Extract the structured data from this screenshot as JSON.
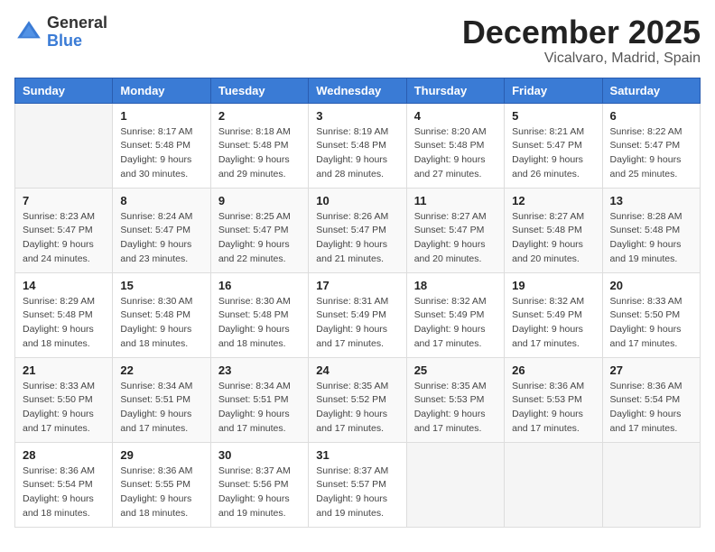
{
  "logo": {
    "general": "General",
    "blue": "Blue"
  },
  "header": {
    "month": "December 2025",
    "location": "Vicalvaro, Madrid, Spain"
  },
  "weekdays": [
    "Sunday",
    "Monday",
    "Tuesday",
    "Wednesday",
    "Thursday",
    "Friday",
    "Saturday"
  ],
  "weeks": [
    [
      {
        "day": "",
        "sunrise": "",
        "sunset": "",
        "daylight": ""
      },
      {
        "day": "1",
        "sunrise": "Sunrise: 8:17 AM",
        "sunset": "Sunset: 5:48 PM",
        "daylight": "Daylight: 9 hours and 30 minutes."
      },
      {
        "day": "2",
        "sunrise": "Sunrise: 8:18 AM",
        "sunset": "Sunset: 5:48 PM",
        "daylight": "Daylight: 9 hours and 29 minutes."
      },
      {
        "day": "3",
        "sunrise": "Sunrise: 8:19 AM",
        "sunset": "Sunset: 5:48 PM",
        "daylight": "Daylight: 9 hours and 28 minutes."
      },
      {
        "day": "4",
        "sunrise": "Sunrise: 8:20 AM",
        "sunset": "Sunset: 5:48 PM",
        "daylight": "Daylight: 9 hours and 27 minutes."
      },
      {
        "day": "5",
        "sunrise": "Sunrise: 8:21 AM",
        "sunset": "Sunset: 5:47 PM",
        "daylight": "Daylight: 9 hours and 26 minutes."
      },
      {
        "day": "6",
        "sunrise": "Sunrise: 8:22 AM",
        "sunset": "Sunset: 5:47 PM",
        "daylight": "Daylight: 9 hours and 25 minutes."
      }
    ],
    [
      {
        "day": "7",
        "sunrise": "Sunrise: 8:23 AM",
        "sunset": "Sunset: 5:47 PM",
        "daylight": "Daylight: 9 hours and 24 minutes."
      },
      {
        "day": "8",
        "sunrise": "Sunrise: 8:24 AM",
        "sunset": "Sunset: 5:47 PM",
        "daylight": "Daylight: 9 hours and 23 minutes."
      },
      {
        "day": "9",
        "sunrise": "Sunrise: 8:25 AM",
        "sunset": "Sunset: 5:47 PM",
        "daylight": "Daylight: 9 hours and 22 minutes."
      },
      {
        "day": "10",
        "sunrise": "Sunrise: 8:26 AM",
        "sunset": "Sunset: 5:47 PM",
        "daylight": "Daylight: 9 hours and 21 minutes."
      },
      {
        "day": "11",
        "sunrise": "Sunrise: 8:27 AM",
        "sunset": "Sunset: 5:47 PM",
        "daylight": "Daylight: 9 hours and 20 minutes."
      },
      {
        "day": "12",
        "sunrise": "Sunrise: 8:27 AM",
        "sunset": "Sunset: 5:48 PM",
        "daylight": "Daylight: 9 hours and 20 minutes."
      },
      {
        "day": "13",
        "sunrise": "Sunrise: 8:28 AM",
        "sunset": "Sunset: 5:48 PM",
        "daylight": "Daylight: 9 hours and 19 minutes."
      }
    ],
    [
      {
        "day": "14",
        "sunrise": "Sunrise: 8:29 AM",
        "sunset": "Sunset: 5:48 PM",
        "daylight": "Daylight: 9 hours and 18 minutes."
      },
      {
        "day": "15",
        "sunrise": "Sunrise: 8:30 AM",
        "sunset": "Sunset: 5:48 PM",
        "daylight": "Daylight: 9 hours and 18 minutes."
      },
      {
        "day": "16",
        "sunrise": "Sunrise: 8:30 AM",
        "sunset": "Sunset: 5:48 PM",
        "daylight": "Daylight: 9 hours and 18 minutes."
      },
      {
        "day": "17",
        "sunrise": "Sunrise: 8:31 AM",
        "sunset": "Sunset: 5:49 PM",
        "daylight": "Daylight: 9 hours and 17 minutes."
      },
      {
        "day": "18",
        "sunrise": "Sunrise: 8:32 AM",
        "sunset": "Sunset: 5:49 PM",
        "daylight": "Daylight: 9 hours and 17 minutes."
      },
      {
        "day": "19",
        "sunrise": "Sunrise: 8:32 AM",
        "sunset": "Sunset: 5:49 PM",
        "daylight": "Daylight: 9 hours and 17 minutes."
      },
      {
        "day": "20",
        "sunrise": "Sunrise: 8:33 AM",
        "sunset": "Sunset: 5:50 PM",
        "daylight": "Daylight: 9 hours and 17 minutes."
      }
    ],
    [
      {
        "day": "21",
        "sunrise": "Sunrise: 8:33 AM",
        "sunset": "Sunset: 5:50 PM",
        "daylight": "Daylight: 9 hours and 17 minutes."
      },
      {
        "day": "22",
        "sunrise": "Sunrise: 8:34 AM",
        "sunset": "Sunset: 5:51 PM",
        "daylight": "Daylight: 9 hours and 17 minutes."
      },
      {
        "day": "23",
        "sunrise": "Sunrise: 8:34 AM",
        "sunset": "Sunset: 5:51 PM",
        "daylight": "Daylight: 9 hours and 17 minutes."
      },
      {
        "day": "24",
        "sunrise": "Sunrise: 8:35 AM",
        "sunset": "Sunset: 5:52 PM",
        "daylight": "Daylight: 9 hours and 17 minutes."
      },
      {
        "day": "25",
        "sunrise": "Sunrise: 8:35 AM",
        "sunset": "Sunset: 5:53 PM",
        "daylight": "Daylight: 9 hours and 17 minutes."
      },
      {
        "day": "26",
        "sunrise": "Sunrise: 8:36 AM",
        "sunset": "Sunset: 5:53 PM",
        "daylight": "Daylight: 9 hours and 17 minutes."
      },
      {
        "day": "27",
        "sunrise": "Sunrise: 8:36 AM",
        "sunset": "Sunset: 5:54 PM",
        "daylight": "Daylight: 9 hours and 17 minutes."
      }
    ],
    [
      {
        "day": "28",
        "sunrise": "Sunrise: 8:36 AM",
        "sunset": "Sunset: 5:54 PM",
        "daylight": "Daylight: 9 hours and 18 minutes."
      },
      {
        "day": "29",
        "sunrise": "Sunrise: 8:36 AM",
        "sunset": "Sunset: 5:55 PM",
        "daylight": "Daylight: 9 hours and 18 minutes."
      },
      {
        "day": "30",
        "sunrise": "Sunrise: 8:37 AM",
        "sunset": "Sunset: 5:56 PM",
        "daylight": "Daylight: 9 hours and 19 minutes."
      },
      {
        "day": "31",
        "sunrise": "Sunrise: 8:37 AM",
        "sunset": "Sunset: 5:57 PM",
        "daylight": "Daylight: 9 hours and 19 minutes."
      },
      {
        "day": "",
        "sunrise": "",
        "sunset": "",
        "daylight": ""
      },
      {
        "day": "",
        "sunrise": "",
        "sunset": "",
        "daylight": ""
      },
      {
        "day": "",
        "sunrise": "",
        "sunset": "",
        "daylight": ""
      }
    ]
  ]
}
